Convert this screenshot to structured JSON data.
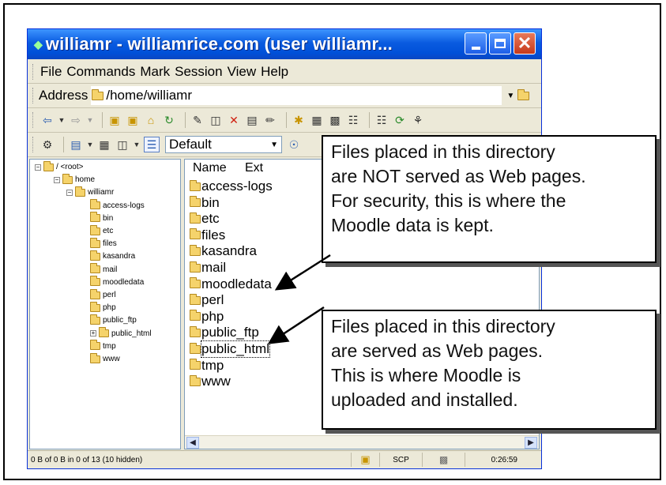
{
  "window": {
    "title": "williamr - williamrice.com (user williamr...",
    "buttons": {
      "minimize": "minimize",
      "maximize": "maximize",
      "close": "✕"
    }
  },
  "menu": [
    "File",
    "Commands",
    "Mark",
    "Session",
    "View",
    "Help"
  ],
  "address": {
    "label": "Address",
    "path": "/home/williamr"
  },
  "toolbar2": {
    "profile": "Default"
  },
  "tree": [
    {
      "label": "/ <root>",
      "depth": 0,
      "expander": "−"
    },
    {
      "label": "home",
      "depth": 1,
      "expander": "−"
    },
    {
      "label": "williamr",
      "depth": 2,
      "expander": "−"
    },
    {
      "label": "access-logs",
      "depth": 3,
      "expander": ""
    },
    {
      "label": "bin",
      "depth": 3,
      "expander": ""
    },
    {
      "label": "etc",
      "depth": 3,
      "expander": ""
    },
    {
      "label": "files",
      "depth": 3,
      "expander": ""
    },
    {
      "label": "kasandra",
      "depth": 3,
      "expander": ""
    },
    {
      "label": "mail",
      "depth": 3,
      "expander": ""
    },
    {
      "label": "moodledata",
      "depth": 3,
      "expander": ""
    },
    {
      "label": "perl",
      "depth": 3,
      "expander": ""
    },
    {
      "label": "php",
      "depth": 3,
      "expander": ""
    },
    {
      "label": "public_ftp",
      "depth": 3,
      "expander": ""
    },
    {
      "label": "public_html",
      "depth": 3,
      "expander": "+"
    },
    {
      "label": "tmp",
      "depth": 3,
      "expander": ""
    },
    {
      "label": "www",
      "depth": 3,
      "expander": ""
    }
  ],
  "list": {
    "columns": [
      "Name",
      "Ext"
    ],
    "items": [
      "access-logs",
      "bin",
      "etc",
      "files",
      "kasandra",
      "mail",
      "moodledata",
      "perl",
      "php",
      "public_ftp",
      "public_html",
      "tmp",
      "www"
    ],
    "selected": "public_html"
  },
  "status": {
    "summary": "0 B of 0 B in 0 of 13 (10 hidden)",
    "protocol": "SCP",
    "elapsed": "0:26:59"
  },
  "callouts": {
    "top": "Files placed in this directory\nare NOT served as Web pages.\nFor security, this is where the\nMoodle data is kept.",
    "bottom": "Files placed in this directory\nare served as Web pages.\nThis is where Moodle is\nuploaded and installed."
  }
}
